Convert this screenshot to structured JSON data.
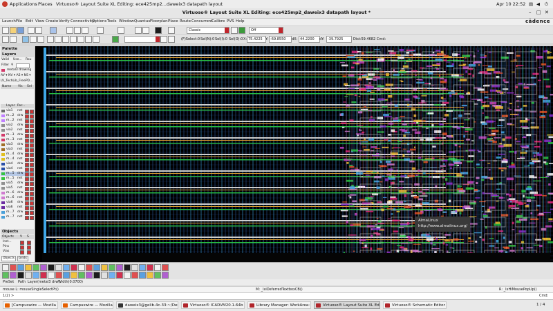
{
  "topbar": {
    "applications": "Applications",
    "places": "Places",
    "window_title": "Virtuoso® Layout Suite XL Editing: ece425mp2...daweix3 datapath layout",
    "clock": "Apr 10  22:52"
  },
  "titlebar": {
    "title": "Virtuoso® Layout Suite XL Editing: ece425mp2_daweix3 datapath layout *"
  },
  "menubar": {
    "items": [
      "Launch",
      "File",
      "Edit",
      "View",
      "Create",
      "Verify",
      "Connectivity",
      "Options",
      "Tools",
      "Window",
      "Quantus",
      "Floorplan",
      "Place",
      "Route",
      "Concurrent",
      "Calibre",
      "PVS",
      "Help"
    ],
    "brand": "cādence"
  },
  "toolbar1": {
    "classic": "Classic",
    "off": "Off"
  },
  "toolbar2": {
    "select_mode": "(F)Select:0",
    "sel_n": "Sel(N):0",
    "sel_i": "Sel(I):0",
    "sel_o": "Sel(O):0",
    "x_label": "X:",
    "x_value": "75.4225",
    "y_label": "Y:",
    "y_value": "-69.8550",
    "dx_label": "dX:",
    "dx_value": "44.2200",
    "dy_label": "dY:",
    "dy_value": "-39.7925",
    "dist": "Dist:59.4682",
    "cmd": "Cmd:"
  },
  "palette": {
    "title": "Palette",
    "layers_title": "Layers",
    "tab_valid": "Valid",
    "tab_used": "Use...",
    "tab_routing": "Rou",
    "filter_label": "Filter",
    "current_layer": "metal3 drawing",
    "av_nv": "AV ▾ NV ▾ AS ▾ NS ▾",
    "tech": "LV_TechLib_FreePD...",
    "cols": {
      "name": "Name",
      "vis": "Vis",
      "sel": "Sel"
    },
    "layer_cols": {
      "layer": "Layer",
      "purpose": "Pur..."
    },
    "layers": [
      {
        "name": "via1",
        "purpose": "net",
        "color": "#6a6a6a"
      },
      {
        "name": "m...2",
        "purpose": "drw",
        "color": "#c080ff"
      },
      {
        "name": "m...2",
        "purpose": "net",
        "color": "#c080ff"
      },
      {
        "name": "via2",
        "purpose": "drw",
        "color": "#8e8e8e"
      },
      {
        "name": "via2",
        "purpose": "net",
        "color": "#8e8e8e"
      },
      {
        "name": "m...3",
        "purpose": "drw",
        "color": "#d23a6a"
      },
      {
        "name": "m...3",
        "purpose": "net",
        "color": "#d23a6a"
      },
      {
        "name": "via3",
        "purpose": "drw",
        "color": "#a07028"
      },
      {
        "name": "via3",
        "purpose": "net",
        "color": "#a07028"
      },
      {
        "name": "m...4",
        "purpose": "drw",
        "color": "#e0c020"
      },
      {
        "name": "m...4",
        "purpose": "net",
        "color": "#e0c020"
      },
      {
        "name": "via4",
        "purpose": "drw",
        "color": "#2a4fa8"
      },
      {
        "name": "via4",
        "purpose": "net",
        "color": "#2a4fa8"
      },
      {
        "name": "m...5",
        "purpose": "drw",
        "color": "#36c440"
      },
      {
        "name": "m...5",
        "purpose": "net",
        "color": "#36c440"
      },
      {
        "name": "via5",
        "purpose": "drw",
        "color": "#909090"
      },
      {
        "name": "via5",
        "purpose": "net",
        "color": "#909090"
      },
      {
        "name": "m...6",
        "purpose": "drw",
        "color": "#d07ad0"
      },
      {
        "name": "m...6",
        "purpose": "net",
        "color": "#d07ad0"
      },
      {
        "name": "via6",
        "purpose": "drw",
        "color": "#6a2aa0"
      },
      {
        "name": "via6",
        "purpose": "net",
        "color": "#6a2aa0"
      },
      {
        "name": "m...7",
        "purpose": "drw",
        "color": "#4aa0d8"
      },
      {
        "name": "m...7",
        "purpose": "net",
        "color": "#4aa0d8"
      }
    ],
    "objects_title": "Objects",
    "objects_cols": {
      "objects": "Objects",
      "v": "V",
      "s": "S"
    },
    "objects": [
      {
        "name": "Inst..."
      },
      {
        "name": "Pins"
      },
      {
        "name": "Vias"
      }
    ],
    "tab_objects": "Objects",
    "tab_grids": "Grids"
  },
  "canvas": {
    "tooltip_line1": "AlmaLinux",
    "tooltip_line2": "http://www.almalinux.org/"
  },
  "status": {
    "preset": "PreSet",
    "path": "Path",
    "layer": "Layer(metal3 drw)",
    "width": "Width(0.0700)"
  },
  "mouse": {
    "left": "mouse L: mouseSingleSelectPt()",
    "mid": "M: _lxiDeferredTextboxCB()",
    "right": "R: _lxHiMousePopUp()"
  },
  "cmdline": {
    "prompt": "1(2)",
    "prompt_symbol": ">",
    "right": "Cmd:"
  },
  "taskbar": {
    "items": [
      {
        "label": "[Campuswire — Mozilla Firefox]",
        "color": "#e66000",
        "active": false
      },
      {
        "label": "Campuswire — Mozilla Firefox",
        "color": "#e66000",
        "active": false
      },
      {
        "label": "daweix3@gelib-4c-33:~/Deskt...",
        "color": "#333333",
        "active": false
      },
      {
        "label": "Virtuoso® ICADVM20.1-64b - ...",
        "color": "#b0242a",
        "active": false
      },
      {
        "label": "Library Manager: WorkArea: ...",
        "color": "#b0242a",
        "active": false
      },
      {
        "label": "Virtuoso® Layout Suite XL Edi...",
        "color": "#b0242a",
        "active": true
      },
      {
        "label": "Virtuoso® Schematic Editor X...",
        "color": "#b0242a",
        "active": false
      }
    ],
    "pager": "1 / 4"
  }
}
